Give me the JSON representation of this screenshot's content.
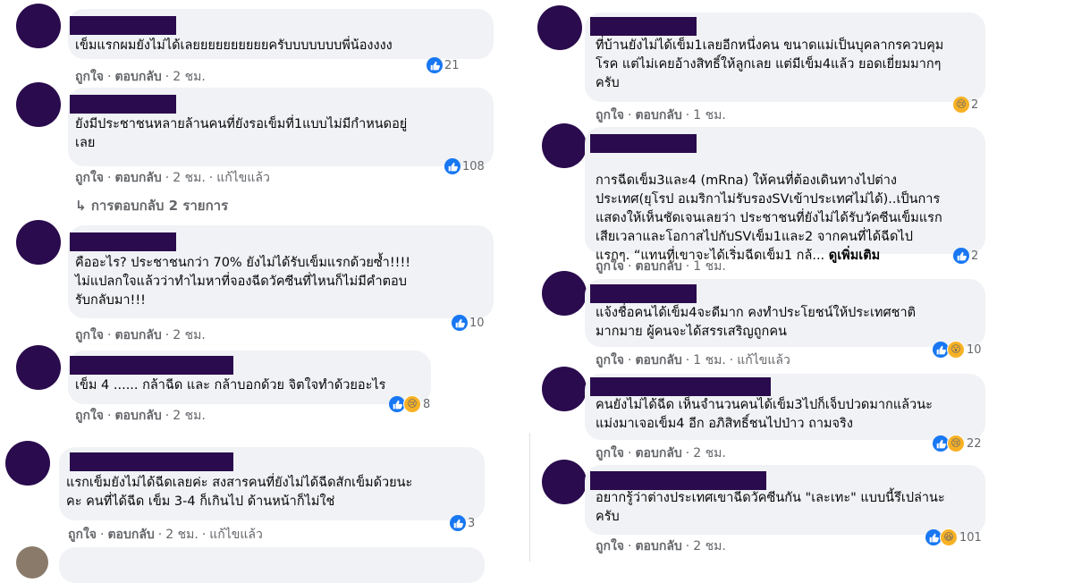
{
  "ui": {
    "like": "ถูกใจ",
    "reply": "ตอบกลับ",
    "sep": "·",
    "edited": "แก้ไขแล้ว"
  },
  "left": [
    {
      "text": "เข็มแรกผมยังไม่ได้เลยยยยยยยยยยครับบบบบบบพี่น้องงงง",
      "time": "2 ชม.",
      "reactions": "21"
    },
    {
      "text": "ยังมีประชาชนหลายล้านคนที่ยังรอเข็มที่1แบบไม่มีกำหนดอยู่\nเลย",
      "time": "2 ชม.",
      "reactions": "108",
      "replies": "การตอบกลับ 2 รายการ"
    },
    {
      "text": "คืออะไร? ประชาชนกว่า 70% ยังไม่ได้รับเข็มแรกด้วยซ้ำ!!!!\nไม่แปลกใจแล้วว่าทำไมหาที่จองฉีดวัคซีนที่ไหนก็ไม่มีคำตอบ\nรับกลับมา!!!",
      "time": "2 ชม.",
      "reactions": "10"
    },
    {
      "text": "เข็ม 4 ...... กล้าฉีด และ กล้าบอกด้วย จิตใจทำด้วยอะไร",
      "time": "2 ชม.",
      "reactions": "8"
    },
    {
      "text": "แรกเข็มยังไม่ได้ฉีดเลยค่ะ สงสารคนที่ยังไม่ได้ฉีดสักเข็มด้วยนะ\nคะ คนที่ได้ฉีด เข็ม 3-4 ก็เกินไป ด้านหน้าก็ไม่ใช่",
      "time": "2 ชม.",
      "reactions": "3"
    }
  ],
  "right": [
    {
      "text": "ที่บ้านยังไม่ได้เข็ม1เลยอีกหนึ่งคน ขนาดแม่เป็นบุคลากรควบคุม\nโรค แต่ไม่เคยอ้างสิทธิ์ให้ลูกเลย แต่มีเข็ม4แล้ว ยอดเยี่ยมมากๆ\nครับ",
      "time": "1 ชม.",
      "reactions": "2"
    },
    {
      "text": "การฉีดเข็ม3และ4 (mRna) ให้คนที่ต้องเดินทางไปต่าง\nประเทศ(ยุโรป อเมริกาไม่รับรองSVเข้าประเทศไม่ได้)..เป็นการ\nแสดงให้เห็นชัดเจนเลยว่า ประชาชนที่ยังไม่ได้รับวัคซีนเข็มแรก\nเสียเวลาและโอกาสไปกับSVเข็ม1และ2 จากคนที่ได้ฉีดไป\nแรกๆ. “แทนที่เขาจะได้เริ่มฉีดเข็ม1 กล้...",
      "more": "ดูเพิ่มเติม",
      "time": "1 ชม.",
      "reactions": "2"
    },
    {
      "text": "แจ้งชื่อคนได้เข็ม4จะดีมาก คงทำประโยชน์ให้ประเทศชาติ\nมากมาย ผู้คนจะได้สรรเสริญถูกคน",
      "time": "1 ชม.",
      "reactions": "10"
    },
    {
      "text": "คนยังไม่ได้ฉีด เห็นจำนวนคนได้เข็ม3ไปก็เจ็บปวดมากแล้วนะ\nแม่งมาเจอเข็ม4 อีก อภิสิทธิ์ชนไปป่าว ถามจริง",
      "time": "2 ชม.",
      "reactions": "22"
    },
    {
      "text": "อยากรู้ว่าต่างประเทศเขาฉีดวัคซีนกัน \"เละเทะ\" แบบนี้รึเปล่านะ\nครับ",
      "time": "2 ชม.",
      "reactions": "101"
    }
  ],
  "reaction_types": [
    "like",
    "like",
    "like",
    "like+sad",
    "like",
    "sad",
    "like",
    "like+wow",
    "like+sad",
    "like+haha"
  ],
  "colors": {
    "avatar": "#2a0b4d",
    "bubble": "#f0f2f5",
    "like": "#1877f2",
    "meta": "#65676b"
  }
}
